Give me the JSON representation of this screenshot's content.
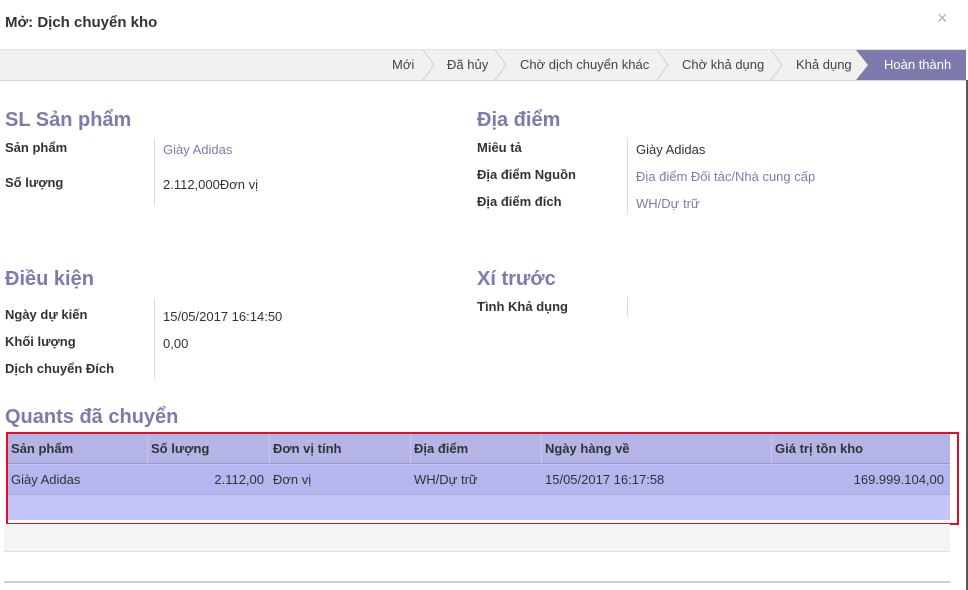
{
  "dialog": {
    "title": "Mở: Dịch chuyển kho",
    "close": "×"
  },
  "statusbar": {
    "stages": [
      "Mới",
      "Đã hủy",
      "Chờ dịch chuyển khác",
      "Chờ khả dụng",
      "Khả dụng",
      "Hoàn thành"
    ],
    "active": "Hoàn thành"
  },
  "product_section": {
    "title": "SL Sản phẩm",
    "product_label": "Sản phẩm",
    "product_value": "Giày Adidas",
    "qty_label": "Số lượng",
    "qty_value": "2.112,000Đơn vị"
  },
  "location_section": {
    "title": "Địa điểm",
    "desc_label": "Miêu tả",
    "desc_value": "Giày Adidas",
    "source_label": "Địa điểm Nguồn",
    "source_value": "Địa điểm Đối tác/Nhà cung cấp",
    "dest_label": "Địa điểm đích",
    "dest_value": "WH/Dự trữ"
  },
  "conditions_section": {
    "title": "Điều kiện",
    "date_label": "Ngày dự kiến",
    "date_value": "15/05/2017 16:14:50",
    "weight_label": "Khối lượng",
    "weight_value": "0,00",
    "dest_move_label": "Dịch chuyển Đích"
  },
  "reserve_section": {
    "title": "Xí trước",
    "availability_label": "Tình Khả dụng"
  },
  "quants": {
    "title": "Quants đã chuyển",
    "columns": [
      "Sản phẩm",
      "Số lượng",
      "Đơn vị tính",
      "Địa điểm",
      "Ngày hàng về",
      "Giá trị tồn kho"
    ],
    "rows": [
      [
        "Giày Adidas",
        "2.112,00",
        "Đơn vị",
        "WH/Dự trữ",
        "15/05/2017 16:17:58",
        "169.999.104,00"
      ]
    ]
  },
  "colors": {
    "accent": "#7c7bad",
    "highlight_border": "#e0102b",
    "grid_bg": "#c5c5fc"
  }
}
